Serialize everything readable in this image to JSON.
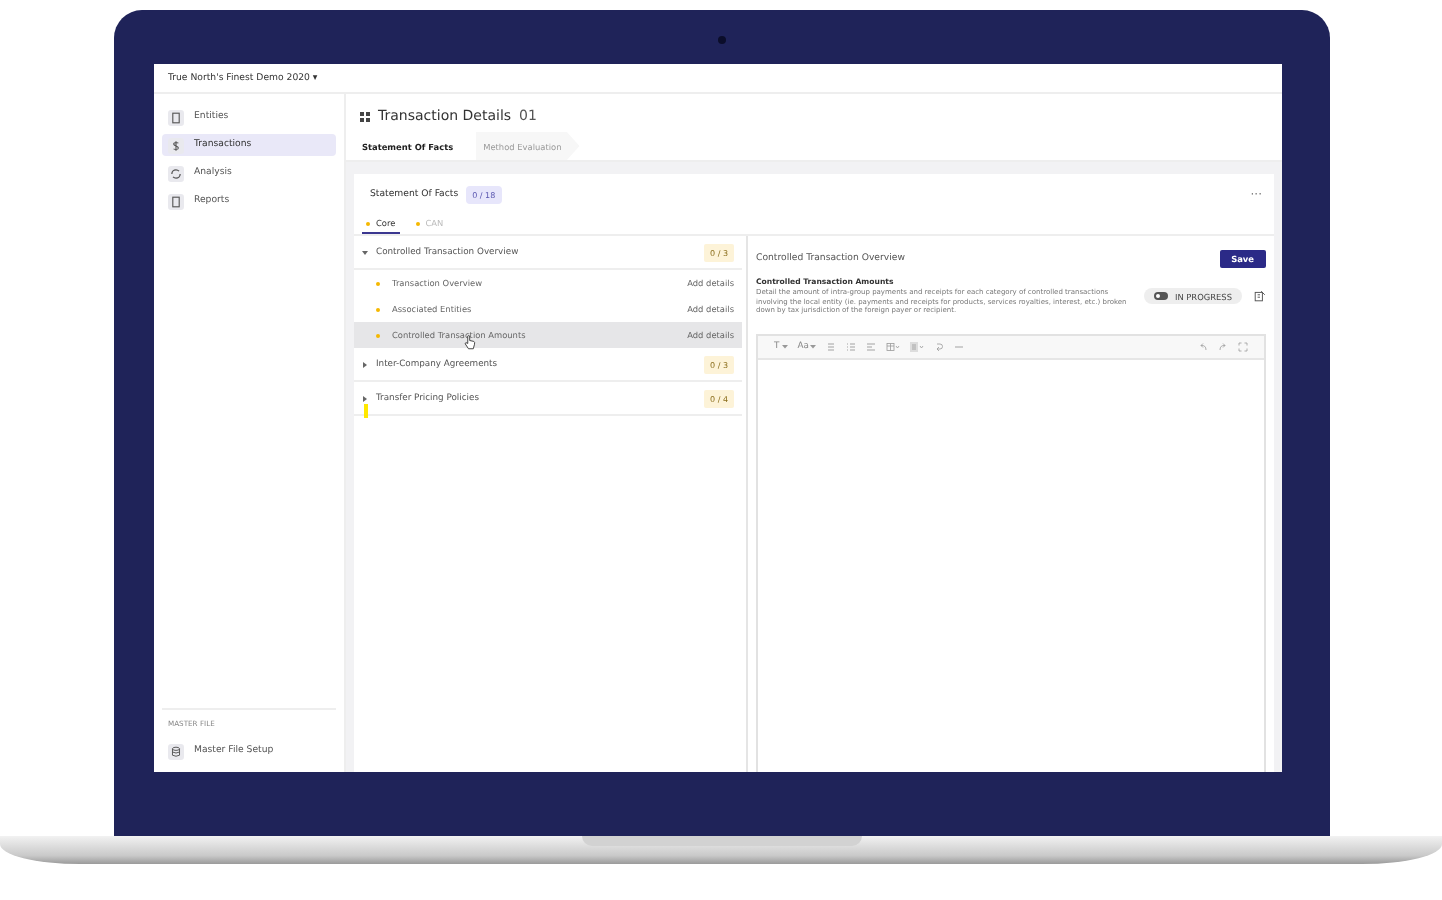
{
  "app": {
    "account": "True North's Finest Demo 2020",
    "caret": "▾"
  },
  "sidebar": {
    "items": [
      {
        "label": "Entities",
        "kind": "document",
        "selected": false
      },
      {
        "label": "Transactions",
        "kind": "dollar",
        "selected": true
      },
      {
        "label": "Analysis",
        "kind": "cycle",
        "selected": false
      },
      {
        "label": "Reports",
        "kind": "document",
        "selected": false
      }
    ],
    "footer": {
      "heading": "MASTER FILE",
      "items": [
        {
          "label": "Master File Setup",
          "kind": "database"
        }
      ]
    }
  },
  "page": {
    "title": "Transaction Details",
    "number": "01",
    "steps": [
      {
        "label": "Statement Of Facts",
        "selected": true
      },
      {
        "label": "Method Evaluation",
        "selected": false
      }
    ]
  },
  "card": {
    "title": "Statement Of Facts",
    "count": "0 / 18",
    "more": "···",
    "tabs": [
      {
        "label": "Core",
        "selected": true
      },
      {
        "label": "CAN",
        "selected": false
      }
    ]
  },
  "sections": [
    {
      "title": "Controlled Transaction Overview",
      "count": "0 / 3",
      "expanded": true,
      "children": [
        {
          "label": "Transaction Overview",
          "action": "Add details",
          "selected": false
        },
        {
          "label": "Associated Entities",
          "action": "Add details",
          "selected": false
        },
        {
          "label": "Controlled Transaction Amounts",
          "action": "Add details",
          "selected": true
        }
      ]
    },
    {
      "title": "Inter-Company Agreements",
      "count": "0 / 3",
      "expanded": false
    },
    {
      "title": "Transfer Pricing Policies",
      "count": "0 / 4",
      "expanded": false
    }
  ],
  "detail": {
    "title": "Controlled Transaction Overview",
    "save": "Save",
    "heading": "Controlled Transaction Amounts",
    "description": "Detail the amount of intra-group payments and receipts for each category of controlled transactions involving the local entity (ie. payments and receipts for products, services royalties, interest, etc.) broken down by tax jurisdiction of the foreign payer or recipient.",
    "status": {
      "label": "IN PROGRESS",
      "on": false
    },
    "toolbar": {
      "text_style": "T",
      "font_size": "Aa"
    }
  }
}
